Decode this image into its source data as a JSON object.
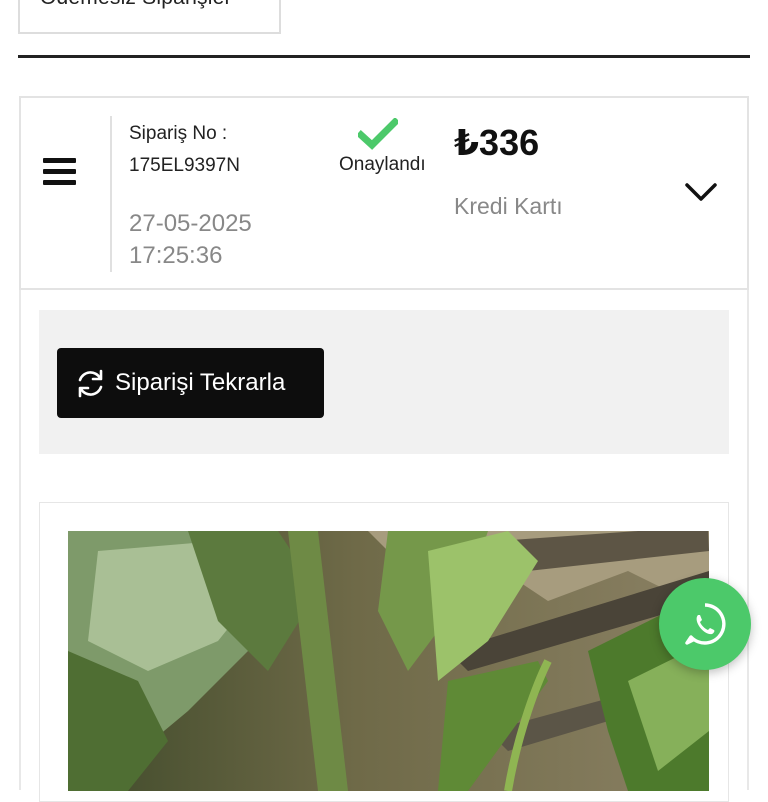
{
  "tabs": {
    "unpaid_orders_label": "Ödemesiz Siparişler"
  },
  "order": {
    "number_label": "Sipariş No :",
    "number": "175EL9397N",
    "date": "27-05-2025",
    "time": "17:25:36",
    "status": "Onaylandı",
    "total": "₺336",
    "payment_method": "Kredi Kartı"
  },
  "actions": {
    "repeat_order_label": "Siparişi Tekrarla"
  },
  "icons": {
    "menu": "hamburger-menu-icon",
    "status": "checkmark-icon",
    "expand": "chevron-down-icon",
    "repeat": "refresh-icon",
    "chat": "whatsapp-icon"
  },
  "colors": {
    "status_check": "#4cc96a",
    "whatsapp": "#4cc96a",
    "button_bg": "#0d0d0d",
    "muted_text": "#888888",
    "action_area_bg": "#f1f1f1"
  }
}
